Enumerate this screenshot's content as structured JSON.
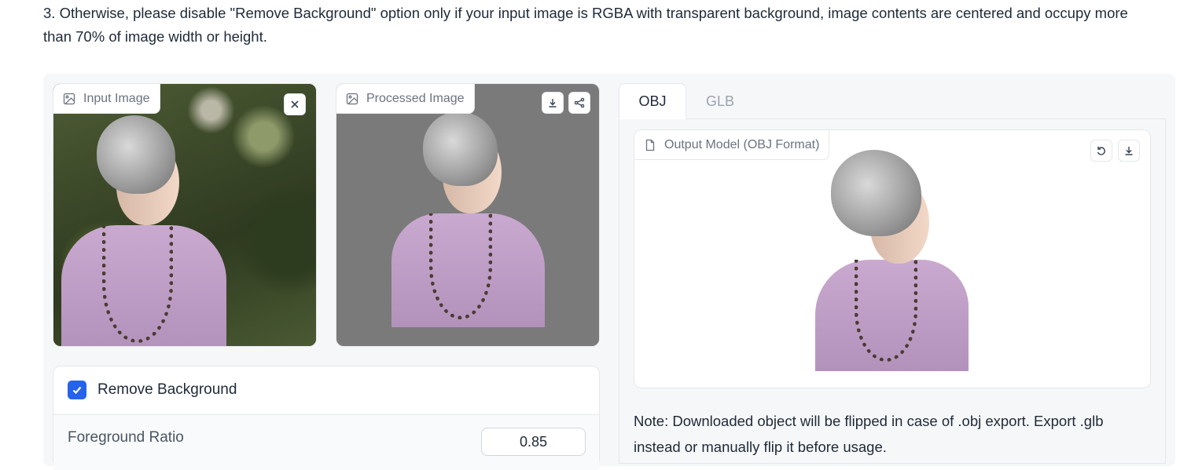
{
  "instruction": {
    "text": "3. Otherwise, please disable \"Remove Background\" option only if your input image is RGBA with transparent background, image contents are centered and occupy more than 70% of image width or height."
  },
  "input_image": {
    "label": "Input Image",
    "icon": "image-icon",
    "clear_icon": "close-icon"
  },
  "processed_image": {
    "label": "Processed Image",
    "icon": "image-icon",
    "download_icon": "download-icon",
    "share_icon": "share-icon"
  },
  "tabs": [
    {
      "label": "OBJ",
      "active": true
    },
    {
      "label": "GLB",
      "active": false
    }
  ],
  "output_model": {
    "label": "Output Model (OBJ Format)",
    "icon": "file-icon",
    "reset_icon": "undo-icon",
    "download_icon": "download-icon"
  },
  "note": {
    "text": "Note: Downloaded object will be flipped in case of .obj export. Export .glb instead or manually flip it before usage."
  },
  "options": {
    "remove_background_label": "Remove Background",
    "remove_background_checked": true,
    "foreground_ratio_label": "Foreground Ratio",
    "foreground_ratio_value": "0.85"
  },
  "colors": {
    "accent": "#2563eb",
    "processed_bg": "#7a7a7a",
    "panel_bg": "#f6f7f9"
  }
}
